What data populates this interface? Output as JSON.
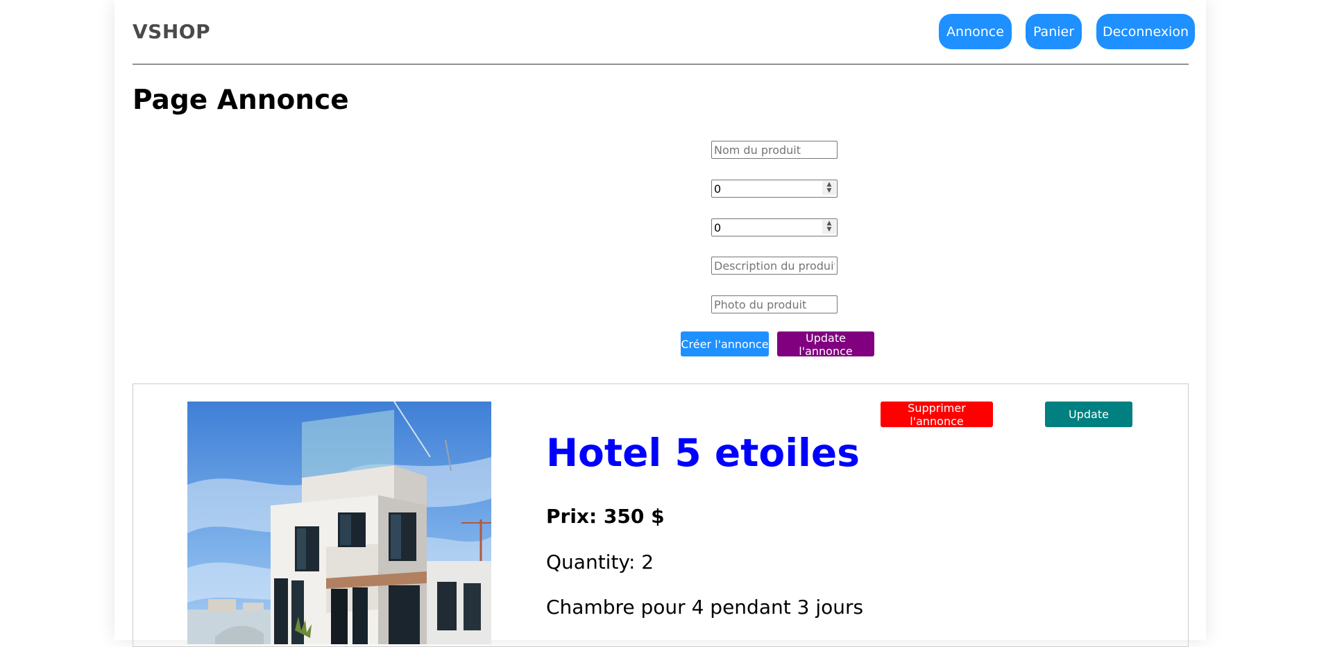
{
  "header": {
    "logo": "VSHOP",
    "nav": {
      "annonce": "Annonce",
      "panier": "Panier",
      "deconnexion": "Deconnexion"
    }
  },
  "page_title": "Page Annonce",
  "form": {
    "name": {
      "placeholder": "Nom du produit",
      "value": ""
    },
    "price": {
      "value": "0"
    },
    "quantity": {
      "value": "0"
    },
    "description": {
      "placeholder": "Description du produit",
      "value": ""
    },
    "photo": {
      "placeholder": "Photo du produit",
      "value": ""
    },
    "create_label": "Créer l'annonce",
    "update_label": "Update l'annonce"
  },
  "listing": {
    "name": "Hotel 5 etoiles",
    "price_label": "Prix: 350 $",
    "quantity_label": "Quantity: 2",
    "description": "Chambre pour 4 pendant 3 jours",
    "delete_label": "Supprimer l'annonce",
    "update_label": "Update"
  },
  "colors": {
    "nav_button": "#1e90ff",
    "create_button": "#1e90ff",
    "update_form_button": "#800080",
    "delete_button": "#ff0000",
    "update_card_button": "#008080",
    "product_name": "#0000ff"
  },
  "icons": {
    "spin": "spinner-arrows-icon"
  }
}
